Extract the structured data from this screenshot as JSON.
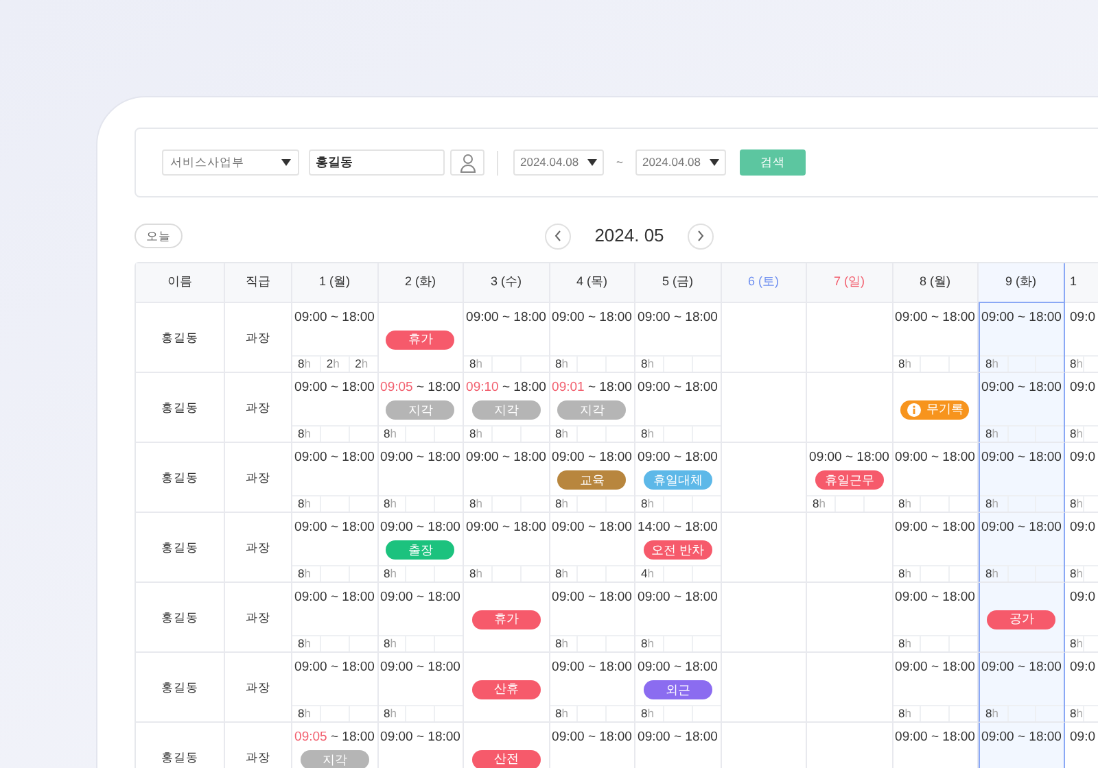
{
  "filter": {
    "department": "서비스사업부",
    "name": "홍길동",
    "date_from": "2024.04.08",
    "range_sep": "~",
    "date_to": "2024.04.08",
    "search_button": "검색"
  },
  "nav": {
    "today_button": "오늘",
    "month": "2024. 05"
  },
  "table": {
    "columns": [
      {
        "label": "이름"
      },
      {
        "label": "직급"
      }
    ],
    "days": [
      {
        "label": "1 (월)",
        "kind": "weekday",
        "selected": false
      },
      {
        "label": "2 (화)",
        "kind": "weekday",
        "selected": false
      },
      {
        "label": "3 (수)",
        "kind": "weekday",
        "selected": false
      },
      {
        "label": "4 (목)",
        "kind": "weekday",
        "selected": false
      },
      {
        "label": "5 (금)",
        "kind": "weekday",
        "selected": false
      },
      {
        "label": "6 (토)",
        "kind": "saturday",
        "selected": false
      },
      {
        "label": "7 (일)",
        "kind": "sunday",
        "selected": false
      },
      {
        "label": "8 (월)",
        "kind": "weekday",
        "selected": false
      },
      {
        "label": "9 (화)",
        "kind": "weekday",
        "selected": true
      },
      {
        "label": "1",
        "kind": "weekday",
        "selected": false
      }
    ],
    "rows": [
      {
        "name": "홍길동",
        "rank": "과장",
        "cells": [
          {
            "time": {
              "start": "09:00",
              "rest": "~ 18:00",
              "late": false
            },
            "hours": [
              {
                "n": "8",
                "u": "h"
              },
              {
                "n": "2",
                "u": "h"
              },
              {
                "n": "2",
                "u": "h"
              }
            ]
          },
          {
            "badge": {
              "label": "휴가",
              "color": "#f65a6b"
            }
          },
          {
            "time": {
              "start": "09:00",
              "rest": "~ 18:00",
              "late": false
            },
            "hours": [
              {
                "n": "8",
                "u": "h"
              }
            ]
          },
          {
            "time": {
              "start": "09:00",
              "rest": "~ 18:00",
              "late": false
            },
            "hours": [
              {
                "n": "8",
                "u": "h"
              }
            ]
          },
          {
            "time": {
              "start": "09:00",
              "rest": "~ 18:00",
              "late": false
            },
            "hours": [
              {
                "n": "8",
                "u": "h"
              }
            ]
          },
          {},
          {},
          {
            "time": {
              "start": "09:00",
              "rest": "~ 18:00",
              "late": false
            },
            "hours": [
              {
                "n": "8",
                "u": "h"
              }
            ]
          },
          {
            "time": {
              "start": "09:00",
              "rest": "~ 18:00",
              "late": false
            },
            "hours": [
              {
                "n": "8",
                "u": "h"
              }
            ]
          },
          {
            "time": {
              "start": "09:0",
              "late": false
            },
            "hours": [
              {
                "n": "8",
                "u": "h"
              }
            ]
          }
        ]
      },
      {
        "name": "홍길동",
        "rank": "과장",
        "cells": [
          {
            "time": {
              "start": "09:00",
              "rest": "~ 18:00",
              "late": false
            },
            "hours": [
              {
                "n": "8",
                "u": "h"
              }
            ]
          },
          {
            "time": {
              "start": "09:05",
              "rest": "~ 18:00",
              "late": true
            },
            "badge": {
              "label": "지각",
              "color": "#b5b5b5"
            },
            "hours": [
              {
                "n": "8",
                "u": "h"
              }
            ]
          },
          {
            "time": {
              "start": "09:10",
              "rest": "~ 18:00",
              "late": true
            },
            "badge": {
              "label": "지각",
              "color": "#b5b5b5"
            },
            "hours": [
              {
                "n": "8",
                "u": "h"
              }
            ]
          },
          {
            "time": {
              "start": "09:01",
              "rest": "~ 18:00",
              "late": true
            },
            "badge": {
              "label": "지각",
              "color": "#b5b5b5"
            },
            "hours": [
              {
                "n": "8",
                "u": "h"
              }
            ]
          },
          {
            "time": {
              "start": "09:00",
              "rest": "~ 18:00",
              "late": false
            },
            "hours": [
              {
                "n": "8",
                "u": "h"
              }
            ]
          },
          {},
          {},
          {
            "badge": {
              "label": "무기록",
              "color": "#f7941d",
              "info": true
            }
          },
          {
            "time": {
              "start": "09:00",
              "rest": "~ 18:00",
              "late": false
            },
            "hours": [
              {
                "n": "8",
                "u": "h"
              }
            ]
          },
          {
            "time": {
              "start": "09:0",
              "late": false
            },
            "hours": [
              {
                "n": "8",
                "u": "h"
              }
            ]
          }
        ]
      },
      {
        "name": "홍길동",
        "rank": "과장",
        "cells": [
          {
            "time": {
              "start": "09:00",
              "rest": "~ 18:00",
              "late": false
            },
            "hours": [
              {
                "n": "8",
                "u": "h"
              }
            ]
          },
          {
            "time": {
              "start": "09:00",
              "rest": "~ 18:00",
              "late": false
            },
            "hours": [
              {
                "n": "8",
                "u": "h"
              }
            ]
          },
          {
            "time": {
              "start": "09:00",
              "rest": "~ 18:00",
              "late": false
            },
            "hours": [
              {
                "n": "8",
                "u": "h"
              }
            ]
          },
          {
            "time": {
              "start": "09:00",
              "rest": "~ 18:00",
              "late": false
            },
            "badge": {
              "label": "교육",
              "color": "#b8863e"
            },
            "hours": [
              {
                "n": "8",
                "u": "h"
              }
            ]
          },
          {
            "time": {
              "start": "09:00",
              "rest": "~ 18:00",
              "late": false
            },
            "badge": {
              "label": "휴일대체",
              "color": "#5db8e8"
            },
            "hours": [
              {
                "n": "8",
                "u": "h"
              }
            ]
          },
          {},
          {
            "time": {
              "start": "09:00",
              "rest": "~ 18:00",
              "late": false
            },
            "badge": {
              "label": "휴일근무",
              "color": "#f65a6b"
            },
            "hours": [
              {
                "n": "8",
                "u": "h"
              }
            ]
          },
          {
            "time": {
              "start": "09:00",
              "rest": "~ 18:00",
              "late": false
            },
            "hours": [
              {
                "n": "8",
                "u": "h"
              }
            ]
          },
          {
            "time": {
              "start": "09:00",
              "rest": "~ 18:00",
              "late": false
            },
            "hours": [
              {
                "n": "8",
                "u": "h"
              }
            ]
          },
          {
            "time": {
              "start": "09:0",
              "late": false
            },
            "hours": [
              {
                "n": "8",
                "u": "h"
              }
            ]
          }
        ]
      },
      {
        "name": "홍길동",
        "rank": "과장",
        "cells": [
          {
            "time": {
              "start": "09:00",
              "rest": "~ 18:00",
              "late": false
            },
            "hours": [
              {
                "n": "8",
                "u": "h"
              }
            ]
          },
          {
            "time": {
              "start": "09:00",
              "rest": "~ 18:00",
              "late": false
            },
            "badge": {
              "label": "출장",
              "color": "#1cc27e"
            },
            "hours": [
              {
                "n": "8",
                "u": "h"
              }
            ]
          },
          {
            "time": {
              "start": "09:00",
              "rest": "~ 18:00",
              "late": false
            },
            "hours": [
              {
                "n": "8",
                "u": "h"
              }
            ]
          },
          {
            "time": {
              "start": "09:00",
              "rest": "~ 18:00",
              "late": false
            },
            "hours": [
              {
                "n": "8",
                "u": "h"
              }
            ]
          },
          {
            "time": {
              "start": "14:00",
              "rest": "~ 18:00",
              "late": false
            },
            "badge": {
              "label": "오전 반차",
              "color": "#f65a6b"
            },
            "hours": [
              {
                "n": "4",
                "u": "h"
              }
            ]
          },
          {},
          {},
          {
            "time": {
              "start": "09:00",
              "rest": "~ 18:00",
              "late": false
            },
            "hours": [
              {
                "n": "8",
                "u": "h"
              }
            ]
          },
          {
            "time": {
              "start": "09:00",
              "rest": "~ 18:00",
              "late": false
            },
            "hours": [
              {
                "n": "8",
                "u": "h"
              }
            ]
          },
          {
            "time": {
              "start": "09:0",
              "late": false
            },
            "hours": [
              {
                "n": "8",
                "u": "h"
              }
            ]
          }
        ]
      },
      {
        "name": "홍길동",
        "rank": "과장",
        "cells": [
          {
            "time": {
              "start": "09:00",
              "rest": "~ 18:00",
              "late": false
            },
            "hours": [
              {
                "n": "8",
                "u": "h"
              }
            ]
          },
          {
            "time": {
              "start": "09:00",
              "rest": "~ 18:00",
              "late": false
            },
            "hours": [
              {
                "n": "8",
                "u": "h"
              }
            ]
          },
          {
            "badge": {
              "label": "휴가",
              "color": "#f65a6b"
            }
          },
          {
            "time": {
              "start": "09:00",
              "rest": "~ 18:00",
              "late": false
            },
            "hours": [
              {
                "n": "8",
                "u": "h"
              }
            ]
          },
          {
            "time": {
              "start": "09:00",
              "rest": "~ 18:00",
              "late": false
            },
            "hours": [
              {
                "n": "8",
                "u": "h"
              }
            ]
          },
          {},
          {},
          {
            "time": {
              "start": "09:00",
              "rest": "~ 18:00",
              "late": false
            },
            "hours": [
              {
                "n": "8",
                "u": "h"
              }
            ]
          },
          {
            "badge": {
              "label": "공가",
              "color": "#f65a6b"
            }
          },
          {
            "time": {
              "start": "09:0",
              "late": false
            },
            "hours": [
              {
                "n": "8",
                "u": "h"
              }
            ]
          }
        ]
      },
      {
        "name": "홍길동",
        "rank": "과장",
        "cells": [
          {
            "time": {
              "start": "09:00",
              "rest": "~ 18:00",
              "late": false
            },
            "hours": [
              {
                "n": "8",
                "u": "h"
              }
            ]
          },
          {
            "time": {
              "start": "09:00",
              "rest": "~ 18:00",
              "late": false
            },
            "hours": [
              {
                "n": "8",
                "u": "h"
              }
            ]
          },
          {
            "badge": {
              "label": "산휴",
              "color": "#f65a6b"
            }
          },
          {
            "time": {
              "start": "09:00",
              "rest": "~ 18:00",
              "late": false
            },
            "hours": [
              {
                "n": "8",
                "u": "h"
              }
            ]
          },
          {
            "time": {
              "start": "09:00",
              "rest": "~ 18:00",
              "late": false
            },
            "badge": {
              "label": "외근",
              "color": "#8b6cf0"
            },
            "hours": [
              {
                "n": "8",
                "u": "h"
              }
            ]
          },
          {},
          {},
          {
            "time": {
              "start": "09:00",
              "rest": "~ 18:00",
              "late": false
            },
            "hours": [
              {
                "n": "8",
                "u": "h"
              }
            ]
          },
          {
            "time": {
              "start": "09:00",
              "rest": "~ 18:00",
              "late": false
            },
            "hours": [
              {
                "n": "8",
                "u": "h"
              }
            ]
          },
          {
            "time": {
              "start": "09:0",
              "late": false
            },
            "hours": [
              {
                "n": "8",
                "u": "h"
              }
            ]
          }
        ]
      },
      {
        "name": "홍길동",
        "rank": "과장",
        "cells": [
          {
            "time": {
              "start": "09:05",
              "rest": "~ 18:00",
              "late": true
            },
            "badge": {
              "label": "지각",
              "color": "#b5b5b5"
            }
          },
          {
            "time": {
              "start": "09:00",
              "rest": "~ 18:00",
              "late": false
            }
          },
          {
            "badge": {
              "label": "산전",
              "color": "#f65a6b"
            }
          },
          {
            "time": {
              "start": "09:00",
              "rest": "~ 18:00",
              "late": false
            }
          },
          {
            "time": {
              "start": "09:00",
              "rest": "~ 18:00",
              "late": false
            }
          },
          {},
          {},
          {
            "time": {
              "start": "09:00",
              "rest": "~ 18:00",
              "late": false
            }
          },
          {
            "time": {
              "start": "09:00",
              "rest": "~ 18:00",
              "late": false
            }
          },
          {
            "time": {
              "start": "09:0",
              "late": false
            }
          }
        ]
      }
    ]
  }
}
